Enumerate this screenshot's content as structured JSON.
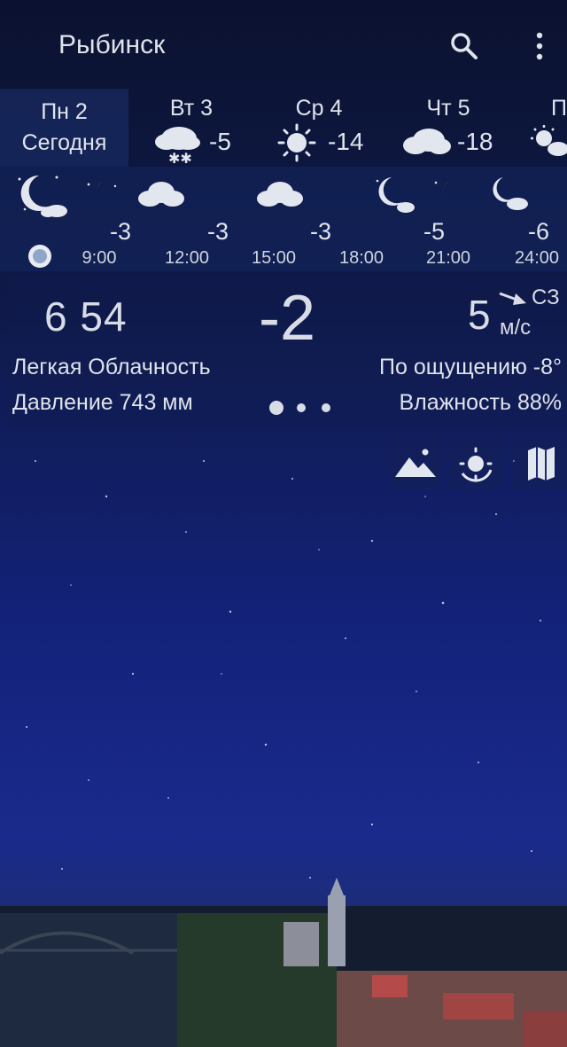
{
  "header": {
    "city": "Рыбинск",
    "icons": [
      "search-icon",
      "more-vert-icon"
    ]
  },
  "days": [
    {
      "name": "Пн 2",
      "sub": "Сегодня"
    },
    {
      "name": "Вт 3",
      "temp": "-5",
      "icon": "snow-cloud-icon"
    },
    {
      "name": "Ср 4",
      "temp": "-14",
      "icon": "sun-icon"
    },
    {
      "name": "Чт 5",
      "temp": "-18",
      "icon": "cloud-icon"
    },
    {
      "name": "П",
      "icon": "sun-cloud-icon"
    }
  ],
  "hourly": [
    {
      "time": "9:00",
      "temp": "-3"
    },
    {
      "time": "12:00",
      "temp": "-3"
    },
    {
      "time": "15:00",
      "temp": "-3"
    },
    {
      "time": "18:00",
      "temp": ""
    },
    {
      "time": "21:00",
      "temp": "-5"
    },
    {
      "time": "24:00",
      "temp": "-6"
    }
  ],
  "current": {
    "time": "6 54",
    "temp": "-2",
    "wind_speed": "5",
    "wind_dir": "СЗ",
    "wind_unit": "м/с",
    "description": "Легкая Облачность",
    "pressure": "Давление 743 мм",
    "feels_like": "По ощущению -8°",
    "humidity": "Влажность 88%"
  },
  "actions": [
    "landscape-icon",
    "sun-rotate-icon",
    "map-icon"
  ],
  "colors": {
    "bg_top": "#0b1230",
    "bg_mid": "#13227a",
    "text": "#e0e4ec"
  }
}
